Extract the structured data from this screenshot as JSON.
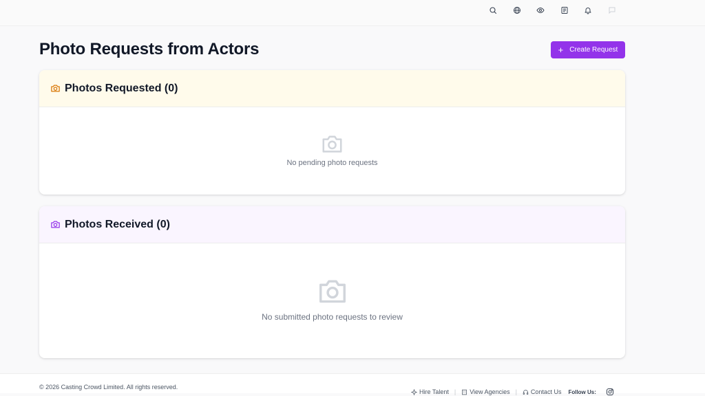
{
  "topbar": {
    "icons": [
      "search-icon",
      "globe-icon",
      "eye-icon",
      "newspaper-icon",
      "bell-icon",
      "chat-icon"
    ]
  },
  "page": {
    "title": "Photo Requests from Actors",
    "create_button_label": "Create Request"
  },
  "sections": [
    {
      "title": "Photos Requested (0)",
      "empty_message": "No pending photo requests",
      "header_bg": "#fffbeb",
      "icon_color": "#d97706"
    },
    {
      "title": "Photos Received (0)",
      "empty_message": "No submitted photo requests to review",
      "header_bg": "#faf5ff",
      "icon_color": "#9333ea"
    }
  ],
  "footer": {
    "copyright": "© 2026 Casting Crowd Limited. All rights reserved.",
    "links": [
      "Hire Talent",
      "View Agencies",
      "Contact Us"
    ],
    "follow_label": "Follow Us:"
  },
  "colors": {
    "accent": "#9333ea"
  }
}
